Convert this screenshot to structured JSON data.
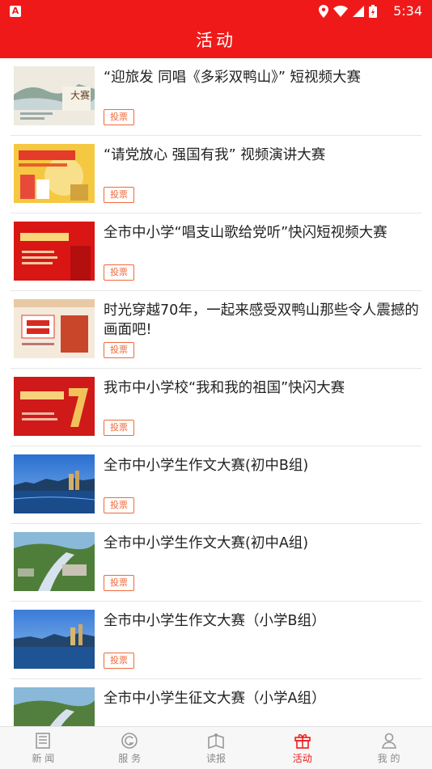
{
  "status": {
    "time": "5:34",
    "app_icon": "A"
  },
  "header": {
    "title": "活动"
  },
  "vote_label": "投票",
  "items": [
    {
      "title": "“迎旅发 同唱《多彩双鸭山》” 短视频大赛"
    },
    {
      "title": "“请党放心 强国有我” 视频演讲大赛"
    },
    {
      "title": "全市中小学“唱支山歌给党听”快闪短视频大赛"
    },
    {
      "title": "时光穿越70年，一起来感受双鸭山那些令人震撼的画面吧!"
    },
    {
      "title": " 我市中小学校“我和我的祖国”快闪大赛"
    },
    {
      "title": "全市中小学生作文大赛(初中B组)"
    },
    {
      "title": "全市中小学生作文大赛(初中A组)"
    },
    {
      "title": "全市中小学生作文大赛（小学B组）"
    },
    {
      "title": "全市中小学生征文大赛（小学A组）"
    }
  ],
  "tabs": [
    {
      "label": "新 闻",
      "icon": "newspaper-icon"
    },
    {
      "label": "服 务",
      "icon": "service-icon"
    },
    {
      "label": "读报",
      "icon": "book-icon"
    },
    {
      "label": "活动",
      "icon": "gift-icon",
      "active": true
    },
    {
      "label": "我 的",
      "icon": "person-icon"
    }
  ],
  "colors": {
    "brand": "#f01919",
    "vote": "#f06a3a"
  }
}
